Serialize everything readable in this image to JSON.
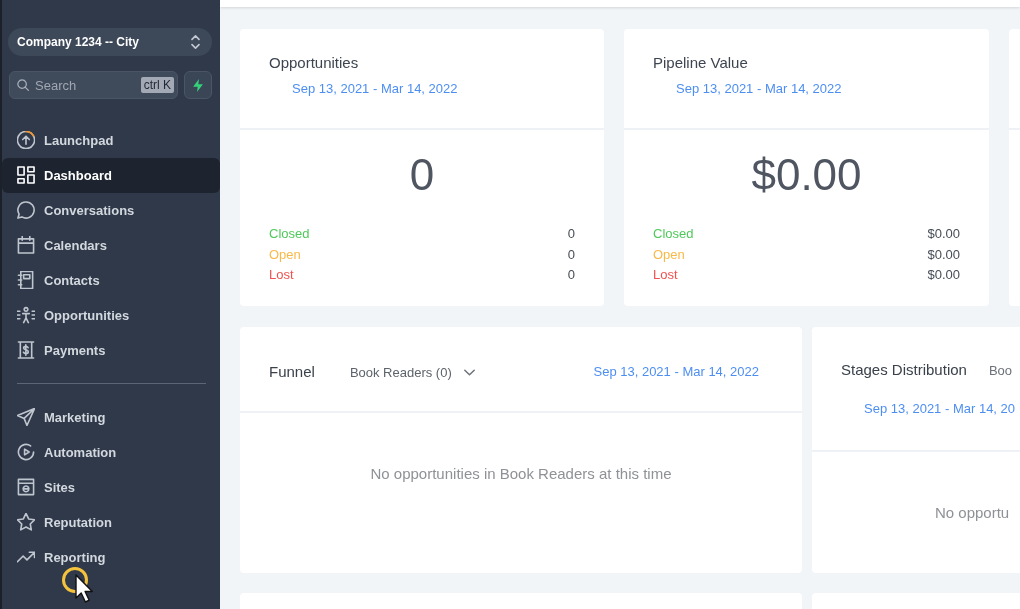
{
  "sidebar": {
    "account_switcher": {
      "label": "Company 1234 -- City"
    },
    "search": {
      "placeholder": "Search",
      "shortcut": "ctrl K"
    },
    "nav_sections": [
      {
        "items": [
          {
            "label": "Launchpad",
            "selected": false
          },
          {
            "label": "Dashboard",
            "selected": true
          },
          {
            "label": "Conversations",
            "selected": false
          },
          {
            "label": "Calendars",
            "selected": false
          },
          {
            "label": "Contacts",
            "selected": false
          },
          {
            "label": "Opportunities",
            "selected": false
          },
          {
            "label": "Payments",
            "selected": false
          }
        ]
      },
      {
        "items": [
          {
            "label": "Marketing",
            "selected": false
          },
          {
            "label": "Automation",
            "selected": false
          },
          {
            "label": "Sites",
            "selected": false
          },
          {
            "label": "Reputation",
            "selected": false
          },
          {
            "label": "Reporting",
            "selected": false
          }
        ]
      }
    ]
  },
  "stat_cards": [
    {
      "title": "Opportunities",
      "date_range": "Sep 13, 2021 - Mar 14, 2022",
      "total": "0",
      "rows": [
        {
          "label": "Closed",
          "value": "0",
          "color": "#4fc95b"
        },
        {
          "label": "Open",
          "value": "0",
          "color": "#f8b94a"
        },
        {
          "label": "Lost",
          "value": "0",
          "color": "#ef5350"
        }
      ]
    },
    {
      "title": "Pipeline Value",
      "date_range": "Sep 13, 2021 - Mar 14, 2022",
      "total": "$0.00",
      "rows": [
        {
          "label": "Closed",
          "value": "$0.00",
          "color": "#4fc95b"
        },
        {
          "label": "Open",
          "value": "$0.00",
          "color": "#f8b94a"
        },
        {
          "label": "Lost",
          "value": "$0.00",
          "color": "#ef5350"
        }
      ]
    }
  ],
  "panels": [
    {
      "kind": "funnel",
      "title": "Funnel",
      "pipeline": "Book Readers (0)",
      "date_range": "Sep 13, 2021 - Mar 14, 2022",
      "empty_message": "No opportunities in Book Readers at this time"
    },
    {
      "kind": "distribution",
      "title": "Stages Distribution",
      "pipeline": "Boo",
      "date_range": "Sep 13, 2021 - Mar 14, 20",
      "empty_message": "No opportu"
    }
  ]
}
